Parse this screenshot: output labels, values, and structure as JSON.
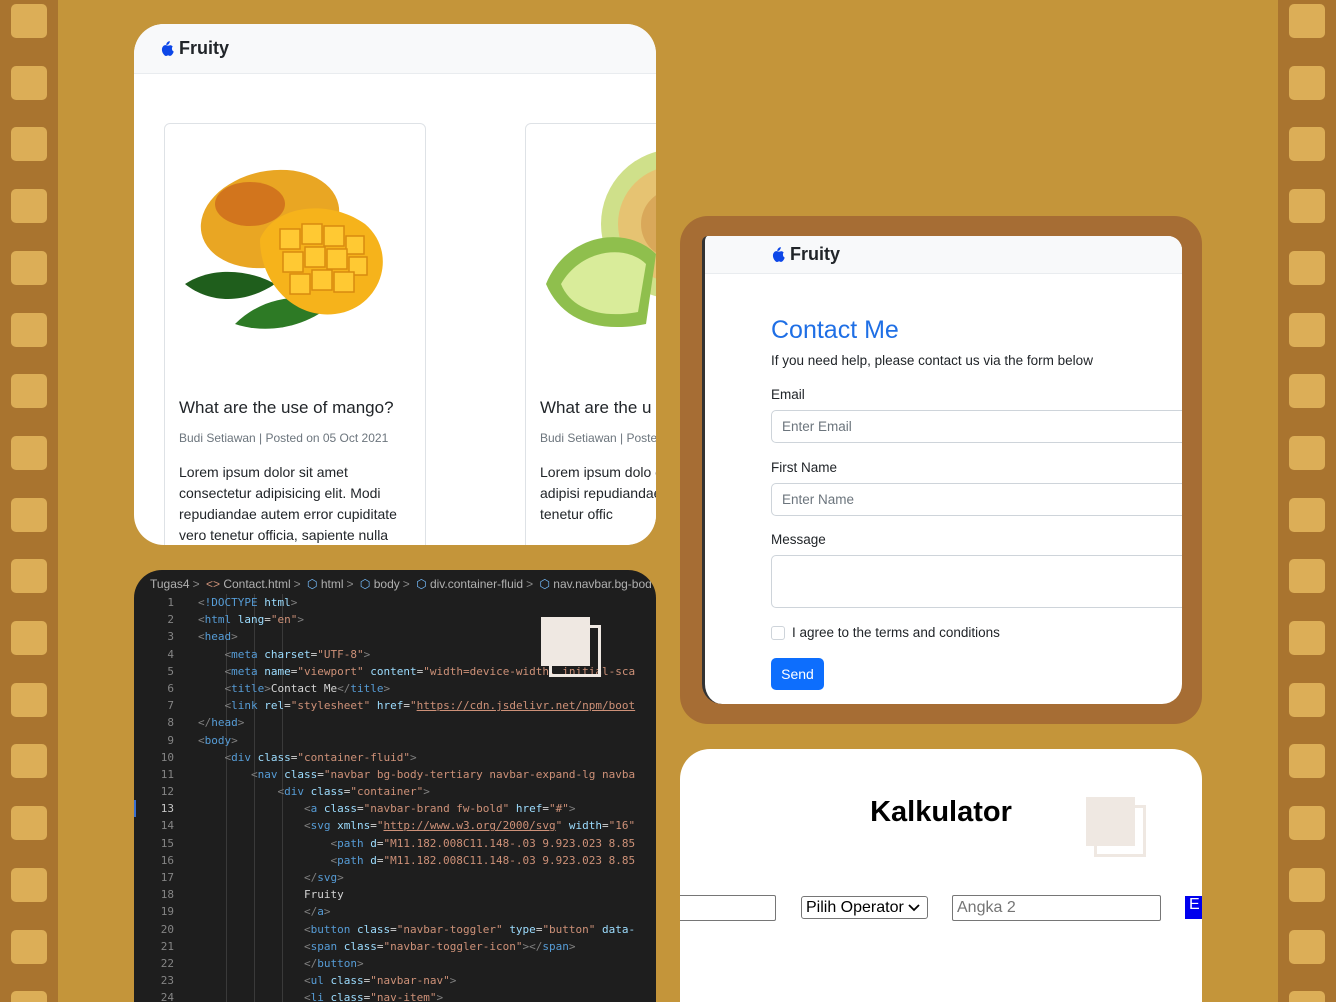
{
  "blog": {
    "brand": "Fruity",
    "posts": [
      {
        "title": "What are the use of mango?",
        "meta": "Budi Setiawan | Posted on 05 Oct 2021",
        "text": "Lorem ipsum dolor sit amet consectetur adipisicing elit. Modi repudiandae autem error cupiditate vero tenetur officia, sapiente nulla"
      },
      {
        "title": "What are the u",
        "meta": "Budi Setiawan | Poste",
        "text": "Lorem ipsum dolo consectetur adipisi repudiandae auten vero tenetur offic"
      }
    ]
  },
  "editor": {
    "breadcrumb": [
      "Tugas4",
      "Contact.html",
      "html",
      "body",
      "div.container-fluid",
      "nav.navbar.bg-bod"
    ],
    "active_line": 13
  },
  "contact": {
    "brand": "Fruity",
    "title": "Contact Me",
    "subtitle": "If you need help, please contact us via the form below",
    "email_label": "Email",
    "email_placeholder": "Enter Email",
    "name_label": "First Name",
    "name_placeholder": "Enter Name",
    "message_label": "Message",
    "agree_label": "I agree to the terms and conditions",
    "send_label": "Send"
  },
  "calculator": {
    "title": "Kalkulator",
    "operator_label": "Pilih Operator",
    "number2_placeholder": "Angka 2",
    "button_label": "E"
  },
  "colors": {
    "background": "#c4953a",
    "film_strip": "#a9742f",
    "contact_frame": "#a66d34",
    "accent_blue": "#1f6fe5"
  }
}
